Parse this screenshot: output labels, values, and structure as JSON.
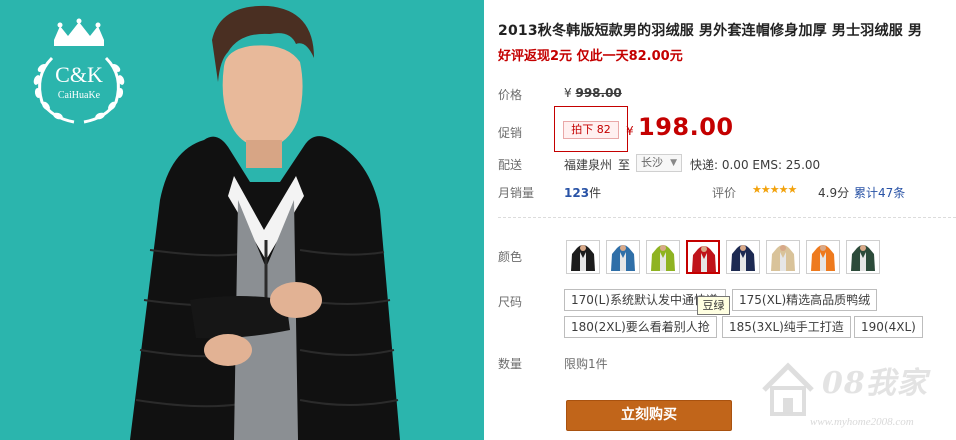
{
  "brand": {
    "logo_lettering": "C&K",
    "logo_subtext": "CaiHuaKe"
  },
  "product": {
    "title": "2013秋冬韩版短款男的羽绒服 男外套连帽修身加厚 男士羽绒服 男",
    "promo_line": "好评返现2元 仅此一天82.00元"
  },
  "price": {
    "label": "价格",
    "currency": "¥",
    "original": "998.00"
  },
  "promotion": {
    "label": "促销",
    "tag": "拍下 82",
    "currency": "¥",
    "sale_price": "198.00"
  },
  "shipping": {
    "label": "配送",
    "origin": "福建泉州",
    "to": "至",
    "destination": "长沙",
    "fees": "快递: 0.00 EMS: 25.00"
  },
  "sales": {
    "label": "月销量",
    "count": "123",
    "unit": "件",
    "rating_label": "评价",
    "stars": "★★★★★",
    "score": "4.9分",
    "total_reviews": "累计47条"
  },
  "color": {
    "label": "颜色",
    "swatches": [
      {
        "name": "black",
        "color": "#1c1c1c",
        "selected": false
      },
      {
        "name": "blue",
        "color": "#2f6fa8",
        "selected": false
      },
      {
        "name": "green",
        "color": "#8fb322",
        "selected": false
      },
      {
        "name": "red",
        "color": "#c0141b",
        "selected": true
      },
      {
        "name": "navy",
        "color": "#1d2a52",
        "selected": false
      },
      {
        "name": "beige",
        "color": "#d9c39a",
        "selected": false
      },
      {
        "name": "orange",
        "color": "#ee7a1e",
        "selected": false
      },
      {
        "name": "dark-green",
        "color": "#2c4b3a",
        "selected": false
      }
    ]
  },
  "size": {
    "label": "尺码",
    "options": [
      "170(L)系统默认发中通快递",
      "175(XL)精选高品质鸭绒",
      "180(2XL)要么看着别人抢",
      "185(3XL)纯手工打造",
      "190(4XL)"
    ],
    "tooltip": "豆绿"
  },
  "quantity": {
    "label": "数量",
    "limit": "限购1件"
  },
  "buy_button": "立刻购买",
  "watermark": {
    "text": "08我家",
    "url": "www.myhome2008.com"
  }
}
